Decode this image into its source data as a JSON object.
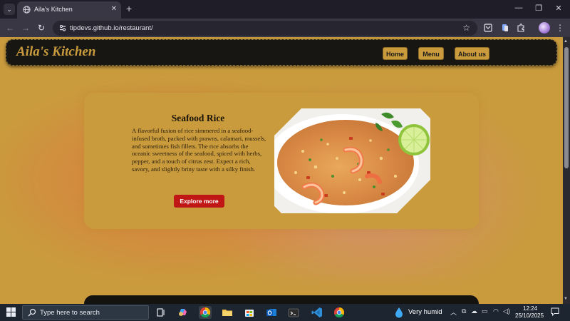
{
  "browser": {
    "tab": {
      "title": "Aila's Kitchen",
      "close_glyph": "✕",
      "favicon": "globe-icon"
    },
    "new_tab_glyph": "+",
    "window_controls": {
      "minimize": "—",
      "restore": "❐",
      "close": "✕"
    },
    "nav": {
      "back": "←",
      "forward": "→",
      "reload": "↻"
    },
    "url": "tipdevs.github.io/restaurant/",
    "bookmark_glyph": "☆"
  },
  "site": {
    "brand": "Aila's Kitchen",
    "nav_links": [
      "Home",
      "Menu",
      "About us"
    ],
    "hero": {
      "title": "Seafood Rice",
      "description": "A flavorful fusion of rice simmered in a seafood-infused broth, packed with prawns, calamari, mussels, and sometimes fish fillets. The rice absorbs the oceanic sweetness of the seafood, spiced with herbs, pepper, and a touch of citrus zest. Expect a rich, savory, and slightly briny taste with a silky finish.",
      "button": "Explore more",
      "image": "seafood-rice-photo"
    },
    "colors": {
      "gold": "#c99b3d",
      "nav_bg": "#171612",
      "button_red": "#c01616"
    }
  },
  "taskbar": {
    "search_placeholder": "Type here to search",
    "weather": "Very humid",
    "time": "12:24",
    "date": "25/10/2025"
  }
}
